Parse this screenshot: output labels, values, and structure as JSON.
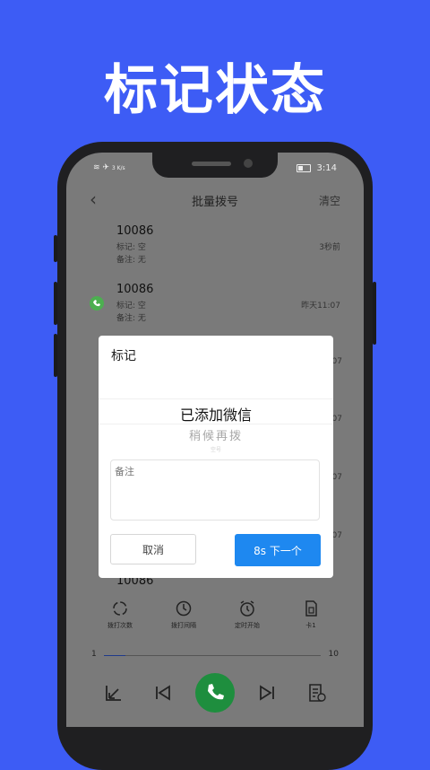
{
  "headline": "标记状态",
  "status": {
    "signal_text": "3 K/s",
    "time": "3:14"
  },
  "nav": {
    "title": "批量拨号",
    "clear": "清空"
  },
  "calls": [
    {
      "number": "10086",
      "mark": "标记: 空",
      "note": "备注: 无",
      "time": "3秒前"
    },
    {
      "number": "10086",
      "mark": "标记: 空",
      "note": "备注: 无",
      "time": "昨天11:07"
    }
  ],
  "side_times": [
    "07",
    "07",
    "07",
    "07"
  ],
  "partial_number": "10086",
  "toolbar": [
    {
      "label": "拨打次数",
      "icon": "loop-icon"
    },
    {
      "label": "拨打间隔",
      "icon": "clock-icon"
    },
    {
      "label": "定时开始",
      "icon": "alarm-icon"
    },
    {
      "label": "卡1",
      "icon": "sim-card-icon"
    }
  ],
  "slider": {
    "min_label": "1",
    "max_label": "10",
    "value_fraction": 0.1
  },
  "dialog": {
    "title": "标记",
    "option_selected": "已添加微信",
    "option_next": "稍候再拨",
    "option_faint": "空号",
    "note_placeholder": "备注",
    "cancel_label": "取消",
    "next_label": "8s 下一个"
  },
  "colors": {
    "background": "#3d5cf5",
    "accent": "#1e88f0",
    "call_green": "#1e8e3e"
  }
}
